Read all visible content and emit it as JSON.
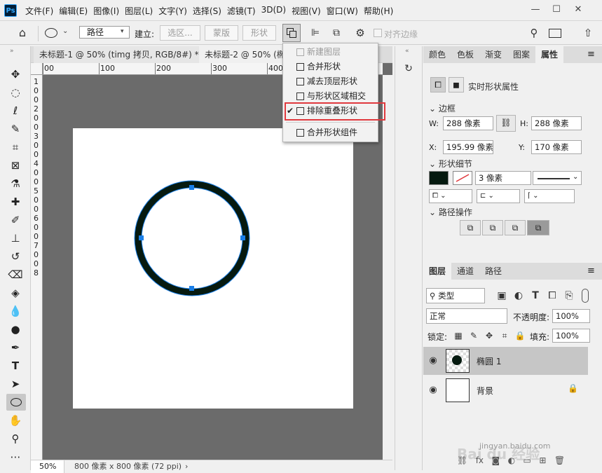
{
  "app": {
    "logo": "Ps"
  },
  "menu": [
    "文件(F)",
    "编辑(E)",
    "图像(I)",
    "图层(L)",
    "文字(Y)",
    "选择(S)",
    "滤镜(T)",
    "3D(D)",
    "视图(V)",
    "窗口(W)",
    "帮助(H)"
  ],
  "window_controls": {
    "minimize": "—",
    "maximize": "☐",
    "close": "✕"
  },
  "options": {
    "mode_value": "路径",
    "build_label": "建立:",
    "selection_btn": "选区...",
    "mask_btn": "蒙版",
    "shape_btn": "形状",
    "align_edges_label": "对齐边缘"
  },
  "tabs": [
    {
      "label": "未标题-1 @ 50% (timg 拷贝, RGB/8#) *",
      "close": "×"
    },
    {
      "label": "未标题-2 @ 50% (椭",
      "close": ""
    }
  ],
  "ruler": {
    "top_ticks": [
      "00",
      "100",
      "200",
      "300",
      "400",
      "500"
    ],
    "left_ticks": [
      "1",
      "0",
      "0",
      "2",
      "0",
      "0",
      "3",
      "0",
      "0",
      "4",
      "0",
      "0",
      "5",
      "0",
      "0",
      "6",
      "0",
      "0",
      "7",
      "0",
      "0",
      "8"
    ]
  },
  "status": {
    "zoom": "50%",
    "doc_info": "800 像素 x 800 像素 (72 ppi)",
    "arrow": "›"
  },
  "dropdown": {
    "items": [
      {
        "label": "新建图层",
        "disabled": true,
        "checked": false
      },
      {
        "label": "合并形状",
        "disabled": false,
        "checked": false
      },
      {
        "label": "减去顶层形状",
        "disabled": false,
        "checked": false
      },
      {
        "label": "与形状区域相交",
        "disabled": false,
        "checked": false
      },
      {
        "label": "排除重叠形状",
        "disabled": false,
        "checked": true
      },
      {
        "label": "合并形状组件",
        "disabled": false,
        "checked": false
      }
    ],
    "check_glyph": "✔",
    "highlight_color": "#e0393e"
  },
  "panel_tabs": [
    "颜色",
    "色板",
    "渐变",
    "图案",
    "属性"
  ],
  "properties": {
    "title": "实时形状属性",
    "bounds_section": "边框",
    "w_label": "W:",
    "w_value": "288 像素",
    "h_label": "H:",
    "h_value": "288 像素",
    "x_label": "X:",
    "x_value": "195.99 像素",
    "y_label": "Y:",
    "y_value": "170 像素",
    "shape_details_section": "形状细节",
    "stroke_width": "3 像素",
    "path_ops_section": "路径操作"
  },
  "layers_panel": {
    "tabs": [
      "图层",
      "通道",
      "路径"
    ],
    "filter_value": "类型",
    "blend_mode": "正常",
    "opacity_label": "不透明度:",
    "opacity_value": "100%",
    "lock_label": "锁定:",
    "fill_label": "填充:",
    "fill_value": "100%",
    "layers": [
      {
        "name": "椭圆 1",
        "selected": true
      },
      {
        "name": "背景",
        "selected": false
      }
    ]
  },
  "watermark": {
    "brand": "Bai du 经验",
    "url": "jingyan.baidu.com"
  },
  "colors": {
    "shape_fill": "#061a10",
    "anchor": "#1a7fe8",
    "canvas_bg": "#6b6b6b",
    "selected_layer": "#c6c6c6"
  }
}
